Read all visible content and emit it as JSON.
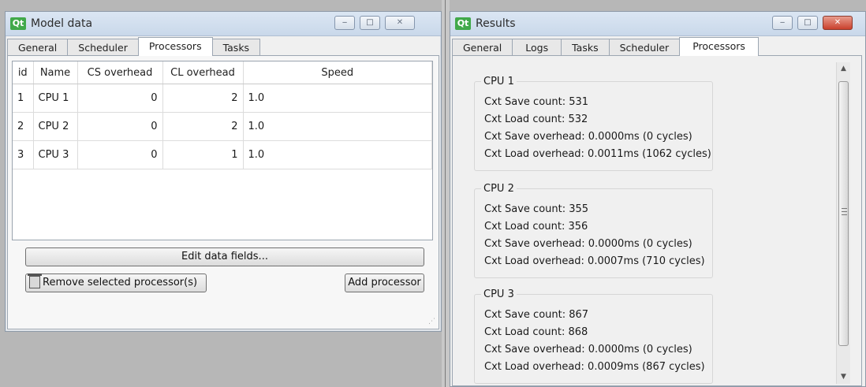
{
  "model_window": {
    "title": "Model data",
    "tabs": [
      "General",
      "Scheduler",
      "Processors",
      "Tasks"
    ],
    "active_tab": "Processors",
    "table": {
      "headers": [
        "id",
        "Name",
        "CS overhead",
        "CL overhead",
        "Speed"
      ],
      "rows": [
        [
          "1",
          "CPU 1",
          "0",
          "2",
          "1.0"
        ],
        [
          "2",
          "CPU 2",
          "0",
          "2",
          "1.0"
        ],
        [
          "3",
          "CPU 3",
          "0",
          "1",
          "1.0"
        ]
      ]
    },
    "edit_button": "Edit data fields...",
    "remove_button": "Remove selected processor(s)",
    "add_button": "Add processor"
  },
  "results_window": {
    "title": "Results",
    "tabs": [
      "General",
      "Logs",
      "Tasks",
      "Scheduler",
      "Processors"
    ],
    "active_tab": "Processors",
    "groups": [
      {
        "title": "CPU 1",
        "lines": [
          "Cxt Save count: 531",
          "Cxt Load count: 532",
          "Cxt Save overhead: 0.0000ms (0 cycles)",
          "Cxt Load overhead: 0.0011ms (1062 cycles)"
        ]
      },
      {
        "title": "CPU 2",
        "lines": [
          "Cxt Save count: 355",
          "Cxt Load count: 356",
          "Cxt Save overhead: 0.0000ms (0 cycles)",
          "Cxt Load overhead: 0.0007ms (710 cycles)"
        ]
      },
      {
        "title": "CPU 3",
        "lines": [
          "Cxt Save count: 867",
          "Cxt Load count: 868",
          "Cxt Save overhead: 0.0000ms (0 cycles)",
          "Cxt Load overhead: 0.0009ms (867 cycles)"
        ]
      }
    ]
  },
  "icons": {
    "qt_logo": "Qt",
    "minimize": "minimize-icon",
    "maximize": "maximize-icon",
    "close": "close-icon",
    "trash": "trash-icon"
  },
  "colors": {
    "qt_green": "#41a94a",
    "close_red": "#c9402c",
    "titlebar": "#c9d8ea"
  }
}
